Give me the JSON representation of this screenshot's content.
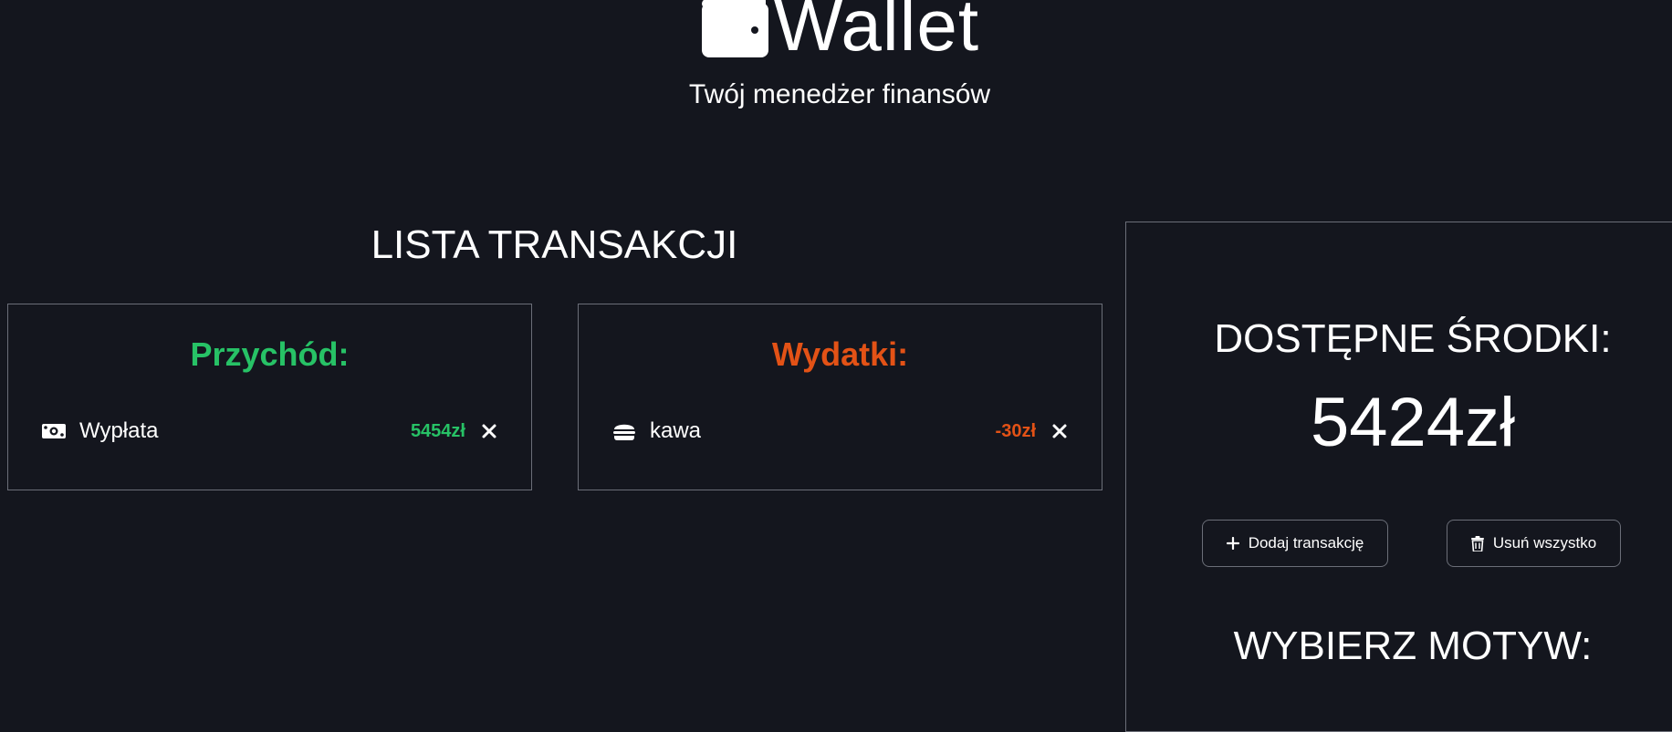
{
  "header": {
    "logo_text": "Wallet",
    "subtitle": "Twój menedżer finansów",
    "logo_icon": "wallet-icon"
  },
  "transactions": {
    "title": "LISTA TRANSAKCJI",
    "income": {
      "title": "Przychód:",
      "color": "#27c266",
      "items": [
        {
          "icon": "money-bill-icon",
          "name": "Wypłata",
          "amount": "5454zł"
        }
      ]
    },
    "expenses": {
      "title": "Wydatki:",
      "color": "#e35216",
      "items": [
        {
          "icon": "burger-icon",
          "name": "kawa",
          "amount": "-30zł"
        }
      ]
    }
  },
  "balance": {
    "title": "DOSTĘPNE ŚRODKI:",
    "value": "5424zł"
  },
  "actions": {
    "add_label": "Dodaj transakcję",
    "clear_label": "Usuń wszystko"
  },
  "theme": {
    "title": "WYBIERZ MOTYW:"
  },
  "colors": {
    "background": "#14161e",
    "border": "#6b6e78",
    "text": "#ffffff"
  }
}
